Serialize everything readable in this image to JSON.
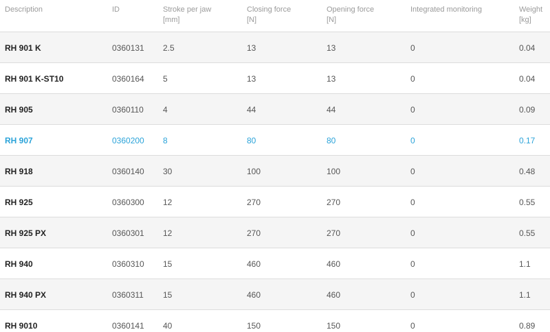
{
  "table": {
    "columns": [
      {
        "label": "Description",
        "unit": ""
      },
      {
        "label": "ID",
        "unit": ""
      },
      {
        "label": "Stroke per jaw",
        "unit": "[mm]"
      },
      {
        "label": "Closing force",
        "unit": "[N]"
      },
      {
        "label": "Opening force",
        "unit": "[N]"
      },
      {
        "label": "Integrated monitoring",
        "unit": ""
      },
      {
        "label": "Weight",
        "unit": "[kg]"
      }
    ],
    "highlight_color": "#2ba3d9",
    "rows": [
      {
        "description": "RH 901 K",
        "id": "0360131",
        "stroke": "2.5",
        "closing": "13",
        "opening": "13",
        "monitoring": "0",
        "weight": "0.04",
        "highlighted": false
      },
      {
        "description": "RH 901 K-ST10",
        "id": "0360164",
        "stroke": "5",
        "closing": "13",
        "opening": "13",
        "monitoring": "0",
        "weight": "0.04",
        "highlighted": false
      },
      {
        "description": "RH 905",
        "id": "0360110",
        "stroke": "4",
        "closing": "44",
        "opening": "44",
        "monitoring": "0",
        "weight": "0.09",
        "highlighted": false
      },
      {
        "description": "RH 907",
        "id": "0360200",
        "stroke": "8",
        "closing": "80",
        "opening": "80",
        "monitoring": "0",
        "weight": "0.17",
        "highlighted": true
      },
      {
        "description": "RH 918",
        "id": "0360140",
        "stroke": "30",
        "closing": "100",
        "opening": "100",
        "monitoring": "0",
        "weight": "0.48",
        "highlighted": false
      },
      {
        "description": "RH 925",
        "id": "0360300",
        "stroke": "12",
        "closing": "270",
        "opening": "270",
        "monitoring": "0",
        "weight": "0.55",
        "highlighted": false
      },
      {
        "description": "RH 925 PX",
        "id": "0360301",
        "stroke": "12",
        "closing": "270",
        "opening": "270",
        "monitoring": "0",
        "weight": "0.55",
        "highlighted": false
      },
      {
        "description": "RH 940",
        "id": "0360310",
        "stroke": "15",
        "closing": "460",
        "opening": "460",
        "monitoring": "0",
        "weight": "1.1",
        "highlighted": false
      },
      {
        "description": "RH 940 PX",
        "id": "0360311",
        "stroke": "15",
        "closing": "460",
        "opening": "460",
        "monitoring": "0",
        "weight": "1.1",
        "highlighted": false
      },
      {
        "description": "RH 9010",
        "id": "0360141",
        "stroke": "40",
        "closing": "150",
        "opening": "150",
        "monitoring": "0",
        "weight": "0.89",
        "highlighted": false
      }
    ]
  }
}
